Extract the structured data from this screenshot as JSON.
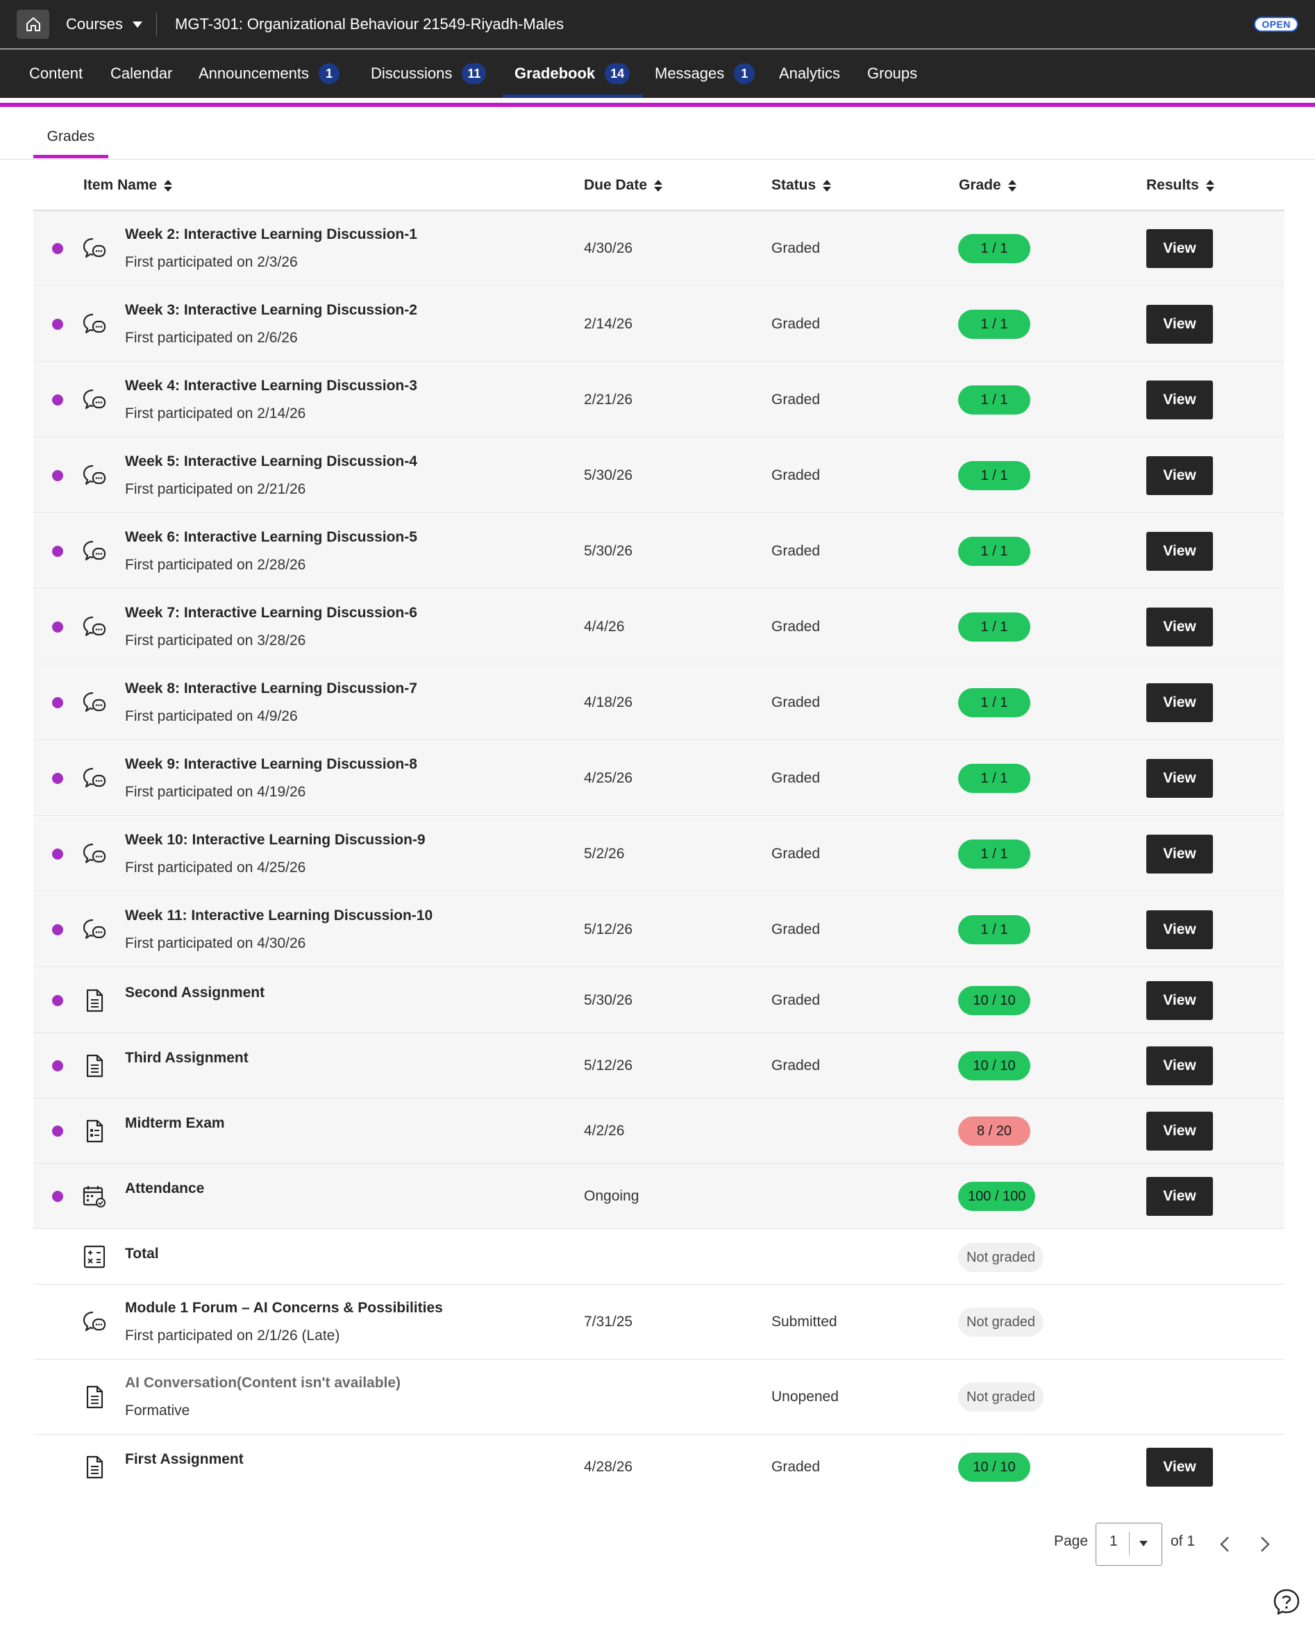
{
  "header": {
    "courses_label": "Courses",
    "course_title": "MGT-301: Organizational Behaviour 21549-Riyadh-Males",
    "status_badge": "OPEN"
  },
  "nav": [
    {
      "label": "Content",
      "badge": ""
    },
    {
      "label": "Calendar",
      "badge": ""
    },
    {
      "label": "Announcements",
      "badge": "1"
    },
    {
      "label": "Discussions",
      "badge": "11"
    },
    {
      "label": "Gradebook",
      "badge": "14"
    },
    {
      "label": "Messages",
      "badge": "1"
    },
    {
      "label": "Analytics",
      "badge": ""
    },
    {
      "label": "Groups",
      "badge": ""
    }
  ],
  "tabs": {
    "grades": "Grades"
  },
  "columns": {
    "item_name": "Item Name",
    "due_date": "Due Date",
    "status": "Status",
    "grade": "Grade",
    "results": "Results"
  },
  "rows": [
    {
      "name": "Week 2: Interactive Learning Discussion-1",
      "sub": "First participated on 2/3/26",
      "due": "4/30/26",
      "status": "Graded",
      "grade": "1 / 1",
      "view": "View"
    },
    {
      "name": "Week 3: Interactive Learning Discussion-2",
      "sub": "First participated on 2/6/26",
      "due": "2/14/26",
      "status": "Graded",
      "grade": "1 / 1",
      "view": "View"
    },
    {
      "name": "Week 4: Interactive Learning Discussion-3",
      "sub": "First participated on 2/14/26",
      "due": "2/21/26",
      "status": "Graded",
      "grade": "1 / 1",
      "view": "View"
    },
    {
      "name": "Week 5: Interactive Learning Discussion-4",
      "sub": "First participated on 2/21/26",
      "due": "5/30/26",
      "status": "Graded",
      "grade": "1 / 1",
      "view": "View"
    },
    {
      "name": "Week 6: Interactive Learning Discussion-5",
      "sub": "First participated on 2/28/26",
      "due": "5/30/26",
      "status": "Graded",
      "grade": "1 / 1",
      "view": "View"
    },
    {
      "name": "Week 7: Interactive Learning Discussion-6",
      "sub": "First participated on 3/28/26",
      "due": "4/4/26",
      "status": "Graded",
      "grade": "1 / 1",
      "view": "View"
    },
    {
      "name": "Week 8: Interactive Learning Discussion-7",
      "sub": "First participated on 4/9/26",
      "due": "4/18/26",
      "status": "Graded",
      "grade": "1 / 1",
      "view": "View"
    },
    {
      "name": "Week 9: Interactive Learning Discussion-8",
      "sub": "First participated on 4/19/26",
      "due": "4/25/26",
      "status": "Graded",
      "grade": "1 / 1",
      "view": "View"
    },
    {
      "name": "Week 10: Interactive Learning Discussion-9",
      "sub": "First participated on 4/25/26",
      "due": "5/2/26",
      "status": "Graded",
      "grade": "1 / 1",
      "view": "View"
    },
    {
      "name": "Week 11: Interactive Learning Discussion-10",
      "sub": "First participated on 4/30/26",
      "due": "5/12/26",
      "status": "Graded",
      "grade": "1 / 1",
      "view": "View"
    },
    {
      "name": "Second Assignment",
      "due": "5/30/26",
      "status": "Graded",
      "grade": "10 / 10",
      "view": "View"
    },
    {
      "name": "Third Assignment",
      "due": "5/12/26",
      "status": "Graded",
      "grade": "10 / 10",
      "view": "View"
    },
    {
      "name": "Midterm Exam",
      "due": "4/2/26",
      "grade": "8 / 20",
      "view": "View"
    },
    {
      "name": "Attendance",
      "due": "Ongoing",
      "grade": "100 / 100",
      "view": "View"
    },
    {
      "name": "Total",
      "grade": "Not graded"
    },
    {
      "name": "Module 1 Forum – AI Concerns & Possibilities",
      "sub": "First participated on 2/1/26 (Late)",
      "due": "7/31/25",
      "status": "Submitted",
      "grade": "Not graded"
    },
    {
      "name": "AI Conversation(Content isn't available)",
      "sub": "Formative",
      "status": "Unopened",
      "grade": "Not graded"
    },
    {
      "name": "First Assignment",
      "due": "4/28/26",
      "status": "Graded",
      "grade": "10 / 10",
      "view": "View"
    }
  ],
  "pager": {
    "page_label": "Page",
    "page_value": "1",
    "of_label": "of 1"
  },
  "icons": [
    "home-icon",
    "discussion-icon",
    "document-icon",
    "exam-icon",
    "calendar-check-icon",
    "calculator-icon",
    "chevron-left-icon",
    "chevron-right-icon",
    "help-icon"
  ],
  "colors": {
    "accent": "#c21ac7",
    "badge": "#1d3a8a",
    "grade_ok": "#22c55e",
    "grade_low": "#f28b8b",
    "unread_dot": "#a22fc0"
  }
}
